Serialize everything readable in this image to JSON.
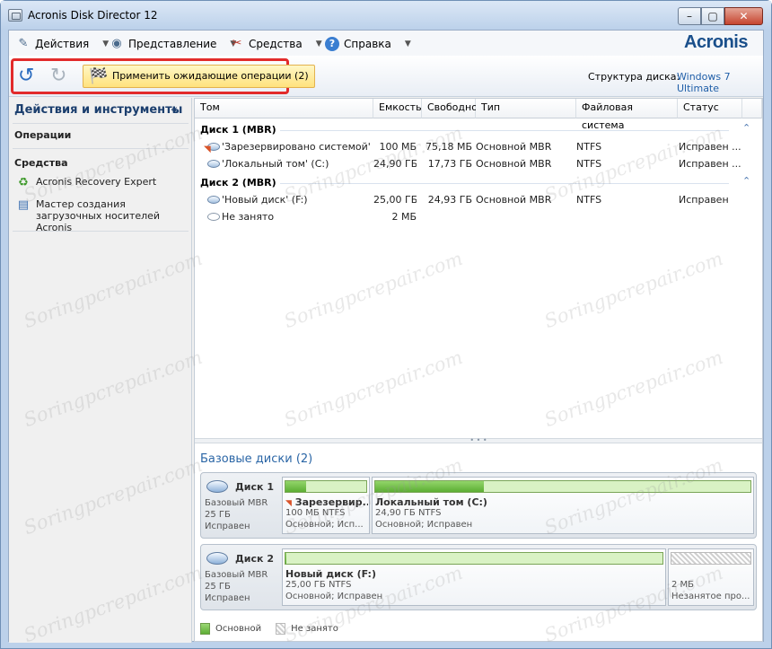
{
  "window": {
    "title": "Acronis Disk Director 12",
    "controls": {
      "minimize": "–",
      "maximize": "▢",
      "close": "✕"
    }
  },
  "menu": {
    "items": [
      {
        "label": "Действия",
        "icon": "actions-icon"
      },
      {
        "label": "Представление",
        "icon": "eye-icon"
      },
      {
        "label": "Средства",
        "icon": "tools-icon"
      },
      {
        "label": "Справка",
        "icon": "help-icon"
      }
    ],
    "logo": "Acronis"
  },
  "toolbar": {
    "apply_label": "Применить ожидающие операции (2)",
    "structure_label": "Структура диска:",
    "structure_value": "Windows 7 Ultimate"
  },
  "sidebar": {
    "title": "Действия и инструменты",
    "collapse": "«",
    "operations_title": "Операции",
    "tools_title": "Средства",
    "tools": [
      {
        "label": "Acronis Recovery Expert",
        "icon": "recovery-expert-icon"
      },
      {
        "label": "Мастер создания загрузочных носителей Acronis",
        "icon": "media-builder-icon"
      }
    ]
  },
  "table": {
    "columns": [
      "Том",
      "Емкость",
      "Свободно",
      "Тип",
      "Файловая система",
      "Статус"
    ],
    "disks": [
      {
        "name": "Диск 1 (MBR)",
        "volumes": [
          {
            "name": "'Зарезервировано системой'",
            "capacity": "100 МБ",
            "free": "75,18 МБ",
            "type": "Основной MBR",
            "fs": "NTFS",
            "status": "Исправен ..."
          },
          {
            "name": "'Локальный том' (C:)",
            "capacity": "24,90 ГБ",
            "free": "17,73 ГБ",
            "type": "Основной MBR",
            "fs": "NTFS",
            "status": "Исправен ..."
          }
        ]
      },
      {
        "name": "Диск 2 (MBR)",
        "volumes": [
          {
            "name": "'Новый диск' (F:)",
            "capacity": "25,00 ГБ",
            "free": "24,93 ГБ",
            "type": "Основной MBR",
            "fs": "NTFS",
            "status": "Исправен"
          },
          {
            "name": "Не занято",
            "capacity": "2 МБ",
            "free": "",
            "type": "",
            "fs": "",
            "status": ""
          }
        ]
      }
    ]
  },
  "basic_disks": {
    "title": "Базовые диски (2)",
    "disks": [
      {
        "name": "Диск 1",
        "type": "Базовый MBR",
        "size": "25 ГБ",
        "status": "Исправен",
        "partitions": [
          {
            "name": "Зарезервир...",
            "size": "100 МБ NTFS",
            "status": "Основной; Исп...",
            "used_fraction": 0.25
          },
          {
            "name": "Локальный том (C:)",
            "size": "24,90 ГБ NTFS",
            "status": "Основной; Исправен",
            "used_fraction": 0.29
          }
        ]
      },
      {
        "name": "Диск 2",
        "type": "Базовый MBR",
        "size": "25 ГБ",
        "status": "Исправен",
        "partitions": [
          {
            "name": "Новый диск (F:)",
            "size": "25,00 ГБ NTFS",
            "status": "Основной; Исправен",
            "used_fraction": 0.003
          },
          {
            "name": "",
            "size": "2 МБ",
            "status": "Незанятое про..."
          }
        ]
      }
    ],
    "legend": {
      "primary": "Основной",
      "unallocated": "Не занято"
    }
  },
  "watermark": "Soringpcrepair.com"
}
